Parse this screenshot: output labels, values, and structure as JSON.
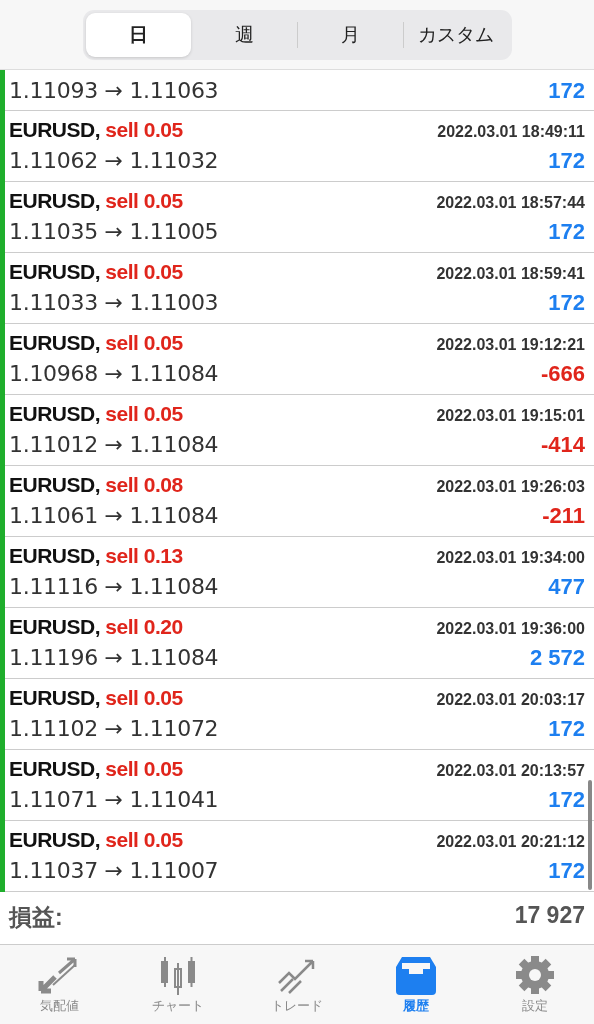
{
  "period_tabs": [
    {
      "label": "日",
      "selected": true
    },
    {
      "label": "週",
      "selected": false
    },
    {
      "label": "月",
      "selected": false
    },
    {
      "label": "カスタム",
      "selected": false
    }
  ],
  "partial_row": {
    "prices": "1.11093 → 1.11063",
    "profit": "172",
    "kind": "profit"
  },
  "deals": [
    {
      "symbol": "EURUSD,",
      "side": "sell 0.05",
      "time": "2022.03.01 18:49:11",
      "prices": "1.11062 → 1.11032",
      "profit": "172",
      "kind": "profit"
    },
    {
      "symbol": "EURUSD,",
      "side": "sell 0.05",
      "time": "2022.03.01 18:57:44",
      "prices": "1.11035 → 1.11005",
      "profit": "172",
      "kind": "profit"
    },
    {
      "symbol": "EURUSD,",
      "side": "sell 0.05",
      "time": "2022.03.01 18:59:41",
      "prices": "1.11033 → 1.11003",
      "profit": "172",
      "kind": "profit"
    },
    {
      "symbol": "EURUSD,",
      "side": "sell 0.05",
      "time": "2022.03.01 19:12:21",
      "prices": "1.10968 → 1.11084",
      "profit": "-666",
      "kind": "loss"
    },
    {
      "symbol": "EURUSD,",
      "side": "sell 0.05",
      "time": "2022.03.01 19:15:01",
      "prices": "1.11012 → 1.11084",
      "profit": "-414",
      "kind": "loss"
    },
    {
      "symbol": "EURUSD,",
      "side": "sell 0.08",
      "time": "2022.03.01 19:26:03",
      "prices": "1.11061 → 1.11084",
      "profit": "-211",
      "kind": "loss"
    },
    {
      "symbol": "EURUSD,",
      "side": "sell 0.13",
      "time": "2022.03.01 19:34:00",
      "prices": "1.11116 → 1.11084",
      "profit": "477",
      "kind": "profit"
    },
    {
      "symbol": "EURUSD,",
      "side": "sell 0.20",
      "time": "2022.03.01 19:36:00",
      "prices": "1.11196 → 1.11084",
      "profit": "2 572",
      "kind": "profit"
    },
    {
      "symbol": "EURUSD,",
      "side": "sell 0.05",
      "time": "2022.03.01 20:03:17",
      "prices": "1.11102 → 1.11072",
      "profit": "172",
      "kind": "profit"
    },
    {
      "symbol": "EURUSD,",
      "side": "sell 0.05",
      "time": "2022.03.01 20:13:57",
      "prices": "1.11071 → 1.11041",
      "profit": "172",
      "kind": "profit"
    },
    {
      "symbol": "EURUSD,",
      "side": "sell 0.05",
      "time": "2022.03.01 20:21:12",
      "prices": "1.11037 → 1.11007",
      "profit": "172",
      "kind": "profit"
    }
  ],
  "summary": {
    "label": "損益:",
    "value": "17 927"
  },
  "tab_bar": [
    {
      "label": "気配値",
      "kind": "quotes",
      "selected": false
    },
    {
      "label": "チャート",
      "kind": "chart",
      "selected": false
    },
    {
      "label": "トレード",
      "kind": "trade",
      "selected": false
    },
    {
      "label": "履歴",
      "kind": "history",
      "selected": true
    },
    {
      "label": "設定",
      "kind": "settings",
      "selected": false
    }
  ]
}
